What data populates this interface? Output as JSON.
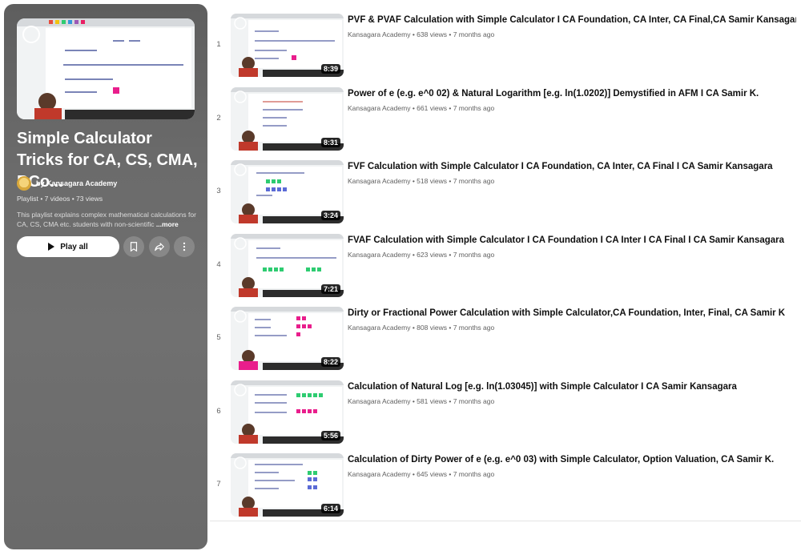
{
  "playlist": {
    "title": "Simple Calculator Tricks for CA, CS, CMA, BCo...",
    "owner": "by Kansagara Academy",
    "type": "Playlist",
    "video_count": "7 videos",
    "views": "73 views",
    "description": "This playlist explains complex mathematical calculations for CA, CS, CMA etc. students with non-scientific",
    "more_label": "...more",
    "play_all_label": "Play all"
  },
  "icons": {
    "play": "play-icon",
    "save": "bookmark-icon",
    "share": "share-icon",
    "more": "more-vert-icon"
  },
  "videos": [
    {
      "index": "1",
      "title": "PVF & PVAF Calculation with Simple Calculator I CA Foundation, CA Inter, CA Final,CA Samir Kansagara",
      "channel": "Kansagara Academy",
      "views": "638 views",
      "age": "7 months ago",
      "duration": "8:39"
    },
    {
      "index": "2",
      "title": "Power of e (e.g. e^0 02) & Natural Logarithm [e.g. ln(1.0202)] Demystified in AFM I CA Samir K.",
      "channel": "Kansagara Academy",
      "views": "661 views",
      "age": "7 months ago",
      "duration": "8:31"
    },
    {
      "index": "3",
      "title": "FVF Calculation with Simple Calculator I CA Foundation, CA Inter, CA Final I CA Samir Kansagara",
      "channel": "Kansagara Academy",
      "views": "518 views",
      "age": "7 months ago",
      "duration": "3:24"
    },
    {
      "index": "4",
      "title": "FVAF Calculation with Simple Calculator I CA Foundation I CA Inter I CA Final I CA Samir Kansagara",
      "channel": "Kansagara Academy",
      "views": "623 views",
      "age": "7 months ago",
      "duration": "7:21"
    },
    {
      "index": "5",
      "title": "Dirty or Fractional Power Calculation with Simple Calculator,CA Foundation, Inter, Final, CA Samir K",
      "channel": "Kansagara Academy",
      "views": "808 views",
      "age": "7 months ago",
      "duration": "8:22"
    },
    {
      "index": "6",
      "title": "Calculation of Natural Log [e.g. ln(1.03045)] with Simple Calculator I CA Samir Kansagara",
      "channel": "Kansagara Academy",
      "views": "581 views",
      "age": "7 months ago",
      "duration": "5:56"
    },
    {
      "index": "7",
      "title": "Calculation of Dirty Power of e (e.g. e^0 03) with Simple Calculator, Option Valuation, CA Samir K.",
      "channel": "Kansagara Academy",
      "views": "645 views",
      "age": "7 months ago",
      "duration": "6:14"
    }
  ]
}
